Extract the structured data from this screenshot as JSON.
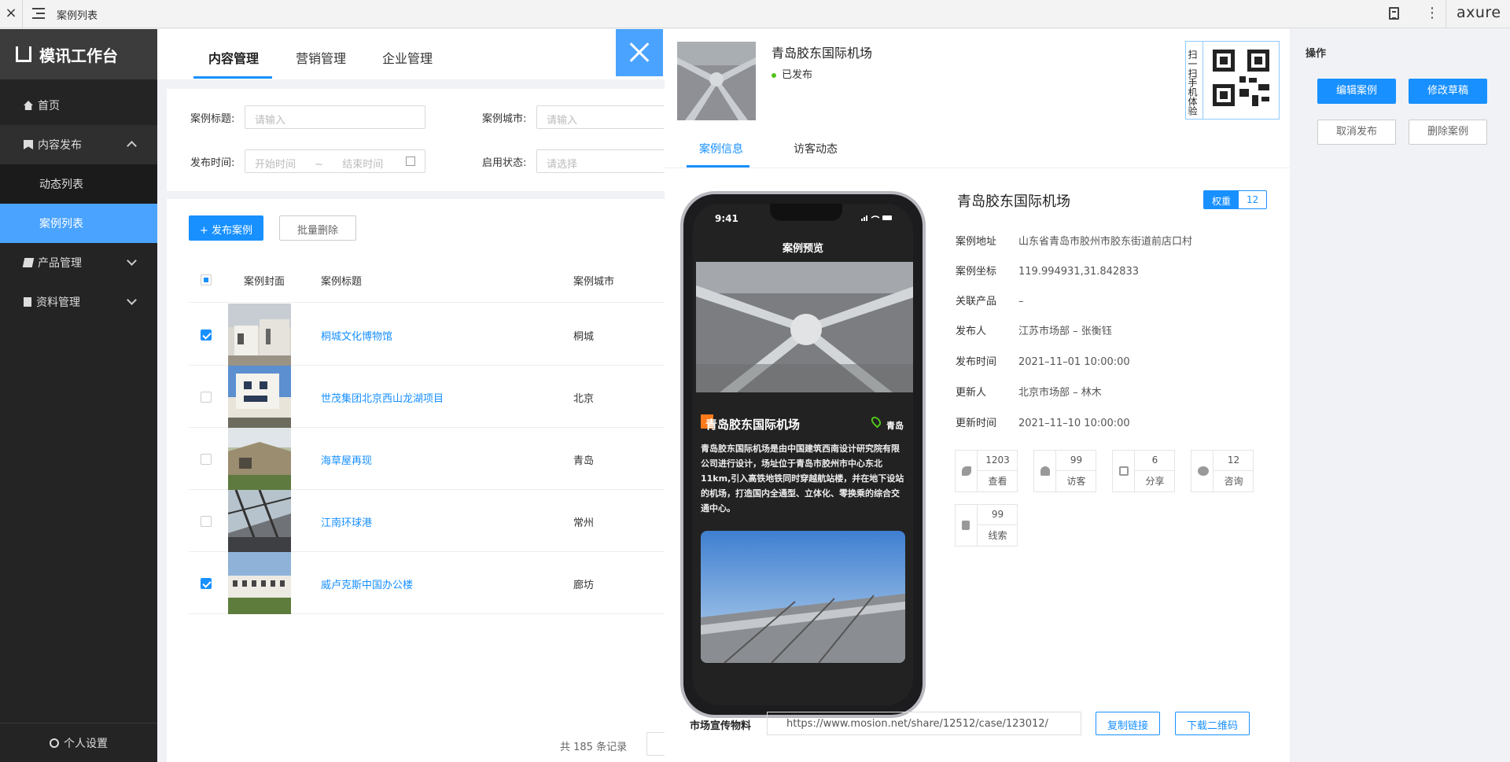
{
  "window": {
    "title": "案例列表",
    "app_logo": "axure"
  },
  "sidebar": {
    "brand": "模讯工作台",
    "items": [
      {
        "label": "首页",
        "icon": "home-icon"
      },
      {
        "label": "内容发布",
        "icon": "bookmark-icon",
        "open": true
      },
      {
        "label": "动态列表",
        "sub": true
      },
      {
        "label": "案例列表",
        "sub": true,
        "active": true
      },
      {
        "label": "产品管理",
        "icon": "book-icon"
      },
      {
        "label": "资料管理",
        "icon": "file-icon"
      }
    ],
    "footer": "个人设置"
  },
  "main": {
    "tabs": [
      "内容管理",
      "营销管理",
      "企业管理"
    ],
    "filter": {
      "title_label": "案例标题:",
      "title_placeholder": "请输入",
      "city_label": "案例城市:",
      "city_placeholder": "请输入",
      "time_label": "发布时间:",
      "start_placeholder": "开始时间",
      "range_sep": "~",
      "end_placeholder": "结束时间",
      "status_label": "启用状态:",
      "status_placeholder": "请选择"
    },
    "actions": {
      "publish": "+ 发布案例",
      "batch_delete": "批量删除"
    },
    "columns": [
      "案例封面",
      "案例标题",
      "案例城市"
    ],
    "rows": [
      {
        "title": "桐城文化博物馆",
        "city": "桐城",
        "checked": true
      },
      {
        "title": "世茂集团北京西山龙湖项目",
        "city": "北京",
        "checked": false
      },
      {
        "title": "海草屋再现",
        "city": "青岛",
        "checked": false
      },
      {
        "title": "江南环球港",
        "city": "常州",
        "checked": false
      },
      {
        "title": "威卢克斯中国办公楼",
        "city": "廊坊",
        "checked": true
      }
    ],
    "total": "共 185 条记录"
  },
  "drawer": {
    "title": "青岛胶东国际机场",
    "status": "已发布",
    "qr_text": "扫一扫手机体验",
    "tabs": [
      "案例信息",
      "访客动态"
    ],
    "phone": {
      "time": "9:41",
      "header": "案例预览",
      "name": "青岛胶东国际机场",
      "city": "青岛",
      "desc": "青岛胶东国际机场是由中国建筑西南设计研究院有限公司进行设计，场址位于青岛市胶州市中心东北11km,引入高铁地铁同时穿越航站楼，并在地下设站的机场，打造国内全通型、立体化、零换乘的综合交通中心。"
    },
    "detail": {
      "title": "青岛胶东国际机场",
      "weight_label": "权重",
      "weight_value": "12",
      "fields": [
        {
          "k": "案例地址",
          "v": "山东省青岛市胶州市胶东街道前店口村"
        },
        {
          "k": "案例坐标",
          "v": "119.994931,31.842833"
        },
        {
          "k": "关联产品",
          "v": "–"
        },
        {
          "k": "发布人",
          "v": "江苏市场部 – 张衡钰"
        },
        {
          "k": "发布时间",
          "v": "2021–11–01  10:00:00"
        },
        {
          "k": "更新人",
          "v": "北京市场部 – 林木"
        },
        {
          "k": "更新时间",
          "v": "2021–11–10  10:00:00"
        }
      ],
      "stats": [
        {
          "num": "1203",
          "label": "查看",
          "icon": "eye-icon"
        },
        {
          "num": "99",
          "label": "访客",
          "icon": "user-icon"
        },
        {
          "num": "6",
          "label": "分享",
          "icon": "share-icon"
        },
        {
          "num": "12",
          "label": "咨询",
          "icon": "chat-icon"
        },
        {
          "num": "99",
          "label": "线索",
          "icon": "file-icon"
        }
      ]
    },
    "share": {
      "label": "市场宣传物料",
      "url": "https://www.mosion.net/share/12512/case/123012/",
      "copy": "复制链接",
      "download": "下载二维码"
    }
  },
  "ops": {
    "title": "操作",
    "edit": "编辑案例",
    "draft": "修改草稿",
    "cancel": "取消发布",
    "delete": "删除案例"
  },
  "colors": {
    "primary": "#1890ff",
    "sidebar_bg": "#242424",
    "active_item": "#4aa3ff",
    "status_dot": "#52c41a"
  }
}
